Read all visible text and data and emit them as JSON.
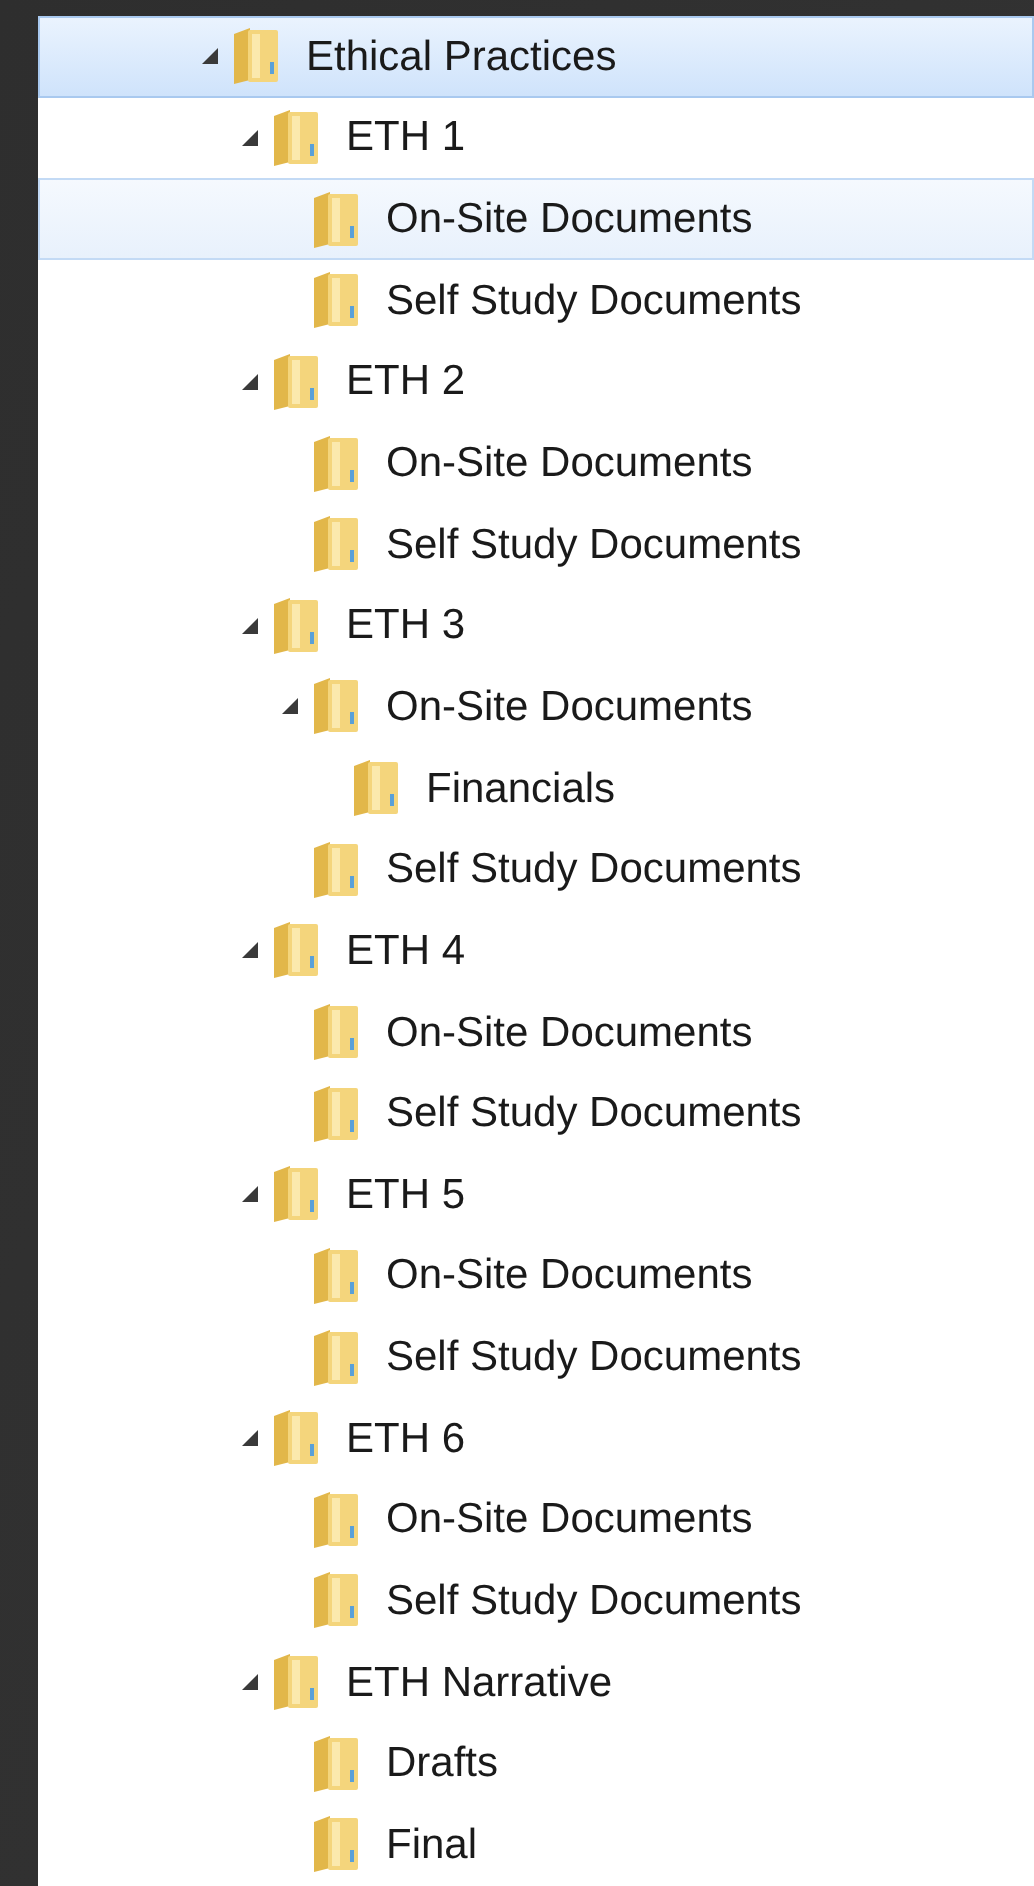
{
  "tree": [
    {
      "label": "Ethical Practices",
      "selected": true,
      "hovered": false,
      "expanded": true,
      "children": [
        {
          "label": "ETH 1",
          "selected": false,
          "hovered": false,
          "expanded": true,
          "children": [
            {
              "label": "On-Site Documents",
              "selected": false,
              "hovered": true
            },
            {
              "label": "Self Study Documents",
              "selected": false,
              "hovered": false
            }
          ]
        },
        {
          "label": "ETH 2",
          "selected": false,
          "hovered": false,
          "expanded": true,
          "children": [
            {
              "label": "On-Site Documents",
              "selected": false,
              "hovered": false
            },
            {
              "label": "Self Study Documents",
              "selected": false,
              "hovered": false
            }
          ]
        },
        {
          "label": "ETH 3",
          "selected": false,
          "hovered": false,
          "expanded": true,
          "children": [
            {
              "label": "On-Site Documents",
              "selected": false,
              "hovered": false,
              "expanded": true,
              "children": [
                {
                  "label": "Financials",
                  "selected": false,
                  "hovered": false
                }
              ]
            },
            {
              "label": "Self Study Documents",
              "selected": false,
              "hovered": false
            }
          ]
        },
        {
          "label": "ETH 4",
          "selected": false,
          "hovered": false,
          "expanded": true,
          "children": [
            {
              "label": "On-Site Documents",
              "selected": false,
              "hovered": false
            },
            {
              "label": "Self Study Documents",
              "selected": false,
              "hovered": false
            }
          ]
        },
        {
          "label": "ETH 5",
          "selected": false,
          "hovered": false,
          "expanded": true,
          "children": [
            {
              "label": "On-Site Documents",
              "selected": false,
              "hovered": false
            },
            {
              "label": "Self Study Documents",
              "selected": false,
              "hovered": false
            }
          ]
        },
        {
          "label": "ETH 6",
          "selected": false,
          "hovered": false,
          "expanded": true,
          "children": [
            {
              "label": "On-Site Documents",
              "selected": false,
              "hovered": false
            },
            {
              "label": "Self Study Documents",
              "selected": false,
              "hovered": false
            }
          ]
        },
        {
          "label": "ETH Narrative",
          "selected": false,
          "hovered": false,
          "expanded": true,
          "children": [
            {
              "label": "Drafts",
              "selected": false,
              "hovered": false
            },
            {
              "label": "Final",
              "selected": false,
              "hovered": false
            }
          ]
        }
      ]
    }
  ]
}
